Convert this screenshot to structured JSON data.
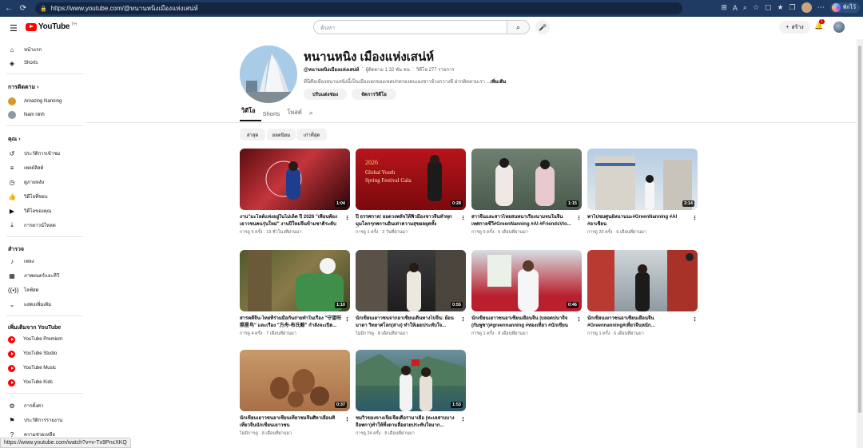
{
  "browser": {
    "url": "https://www.youtube.com/@หนานหนิงเมืองแห่งเสน่ห์",
    "copilot_label": "พักไว้"
  },
  "topbar": {
    "logo_text": "YouTube",
    "logo_country": "TH",
    "search_placeholder": "ค้นหา",
    "create_label": "สร้าง",
    "notif_count": "1"
  },
  "sidebar": {
    "home": "หน้าแรก",
    "shorts": "Shorts",
    "subs_header": "การติดตาม",
    "subs": [
      "Amazing Nanning",
      "Nam ninh"
    ],
    "you_header": "คุณ",
    "you_items": [
      "ประวัติการเข้าชม",
      "เพลย์ลิสต์",
      "ดูภายหลัง",
      "วิดีโอที่ชอบ",
      "วิดีโอของคุณ",
      "การดาวน์โหลด"
    ],
    "explore_header": "สำรวจ",
    "explore_items": [
      "เพลง",
      "ภาพยนตร์และทีวี",
      "ไลฟ์สด",
      "แสดงเพิ่มเติม"
    ],
    "more_header": "เพิ่มเติมจาก YouTube",
    "more_items": [
      "YouTube Premium",
      "YouTube Studio",
      "YouTube Music",
      "YouTube Kids"
    ],
    "settings_items": [
      "การตั้งค่า",
      "ประวัติการรายงาน",
      "ความช่วยเหลือ"
    ]
  },
  "channel": {
    "name": "หนานหนิง เมืองแห่งเสน่ห์",
    "handle": "@หนานหนิงเมืองแห่งเสน่ห์",
    "subs": "ผู้ติดตาม 1.32 พัน คน",
    "videos": "วิดีโอ 277 รายการ",
    "desc": "ที่นี่คือเมืองหนานหนิงนี้เป็นเมืองเอกของเขตปกครองตนเองชาวจ้วงกวางซี ฝากติดตามเรา ...",
    "desc_more": "เพิ่มเติม",
    "customize_btn": "ปรับแต่งช่อง",
    "manage_btn": "จัดการวิดีโอ"
  },
  "tabs": [
    "วิดีโอ",
    "Shorts",
    "โพสต์"
  ],
  "chips": [
    "ล่าสุด",
    "ยอดนิยม",
    "เก่าที่สุด"
  ],
  "videos": [
    {
      "title": "งาน\"มะโลต์แห่งอยู่ในไม่เล็ด ปี 2026 \"เพื่อนพ้อง เยาวชนคนรุ่นใหม่\" งานปีใหม่จีนข้ามชาติระดับไ...",
      "meta": "การดู 5 ครั้ง · 19 ชั่วโมงที่ผ่านมา",
      "dur": "1:04"
    },
    {
      "title": "ปี ธรรศกาล! ยอดวงพลัจให้ฟิวมีองชาวจีนทั่วทุกมุมโลกๆกพกานอินเด่าความสุขผลยุดทั้งโฮ#fyppp...",
      "meta": "การดู 1 ครั้ง · 3 วันที่ผ่านมา",
      "dur": "0:28"
    },
    {
      "title": "สาวจีนและสาวไทยสนทนาเรื่องนามจนในจีน เทศกาลชีวี#GreenNanning #AI #FriendsVlo...",
      "meta": "การดู 5 ครั้ง · 5 เดือนที่ผ่านมา",
      "dur": "1:15"
    },
    {
      "title": "พาไปชมศูนย์หนานนะ#GreenNanning #AI #อาเซียน",
      "meta": "การดู 20 ครั้ง · 6 เดือนที่ผ่านมา",
      "dur": "3:14"
    },
    {
      "title": "สารคดีจีน-ไทยที่ร่วมมือกันถ่ายทำในเรือง \"守望旺 照星鸟\" และเรือง \"方舟-布氏鲸\" กำลังจะเปิด...",
      "meta": "การดู 4 ครั้ง · 7 เดือนที่ผ่านมา",
      "dur": "1:10"
    },
    {
      "title": "นักเขียนเยาวชนจากอาเซียนเดินทางไปจีน: ย้อนมาตา วิทยาศโลก(ล่าง) ทำให้เผยประทับใจ...",
      "meta": "ไม่มีการดู · 8 เดือนที่ผ่านมา",
      "dur": "0:55"
    },
    {
      "title": "นักเขียนเยาวชนอาเซียนเยือนจีน |บลอดปนาจีจ (กัมพูชา)#greennanning #ท่องเที่ยว #นักเขียน",
      "meta": "การดู 1 ครั้ง · 8 เดือนที่ผ่านมา",
      "dur": "0:46"
    },
    {
      "title": "นักเขียนเยาวชนอาเซียนเยือนจีน #Greennanning#เที่ยวจีนหนัก...",
      "meta": "การดู 1 ครั้ง · 6 เดือนที่ผ่านมา",
      "dur": ""
    },
    {
      "title": "นักเขียนเยาวชนอาเซียนเที่ยวชมจีนศิลาเยือนทิเที่ยวจีนนักเขียนเยาวชน",
      "meta": "ไม่มีการดู · 8 เดือนที่ผ่านมา",
      "dur": "0:37"
    },
    {
      "title": "ชมวิวของจางเจียเจี้ยเดือรามาเยือ (ทะเลสาบบาง จีอพกา)ทำให้ทึ่งตามลื่อยวยประทับใจมาก...",
      "meta": "การดู 24 ครั้ง · 8 เดือนที่ผ่านมา",
      "dur": "1:53"
    }
  ],
  "status_url": "https://www.youtube.com/watch?v=v-Tx9PncXKQ"
}
